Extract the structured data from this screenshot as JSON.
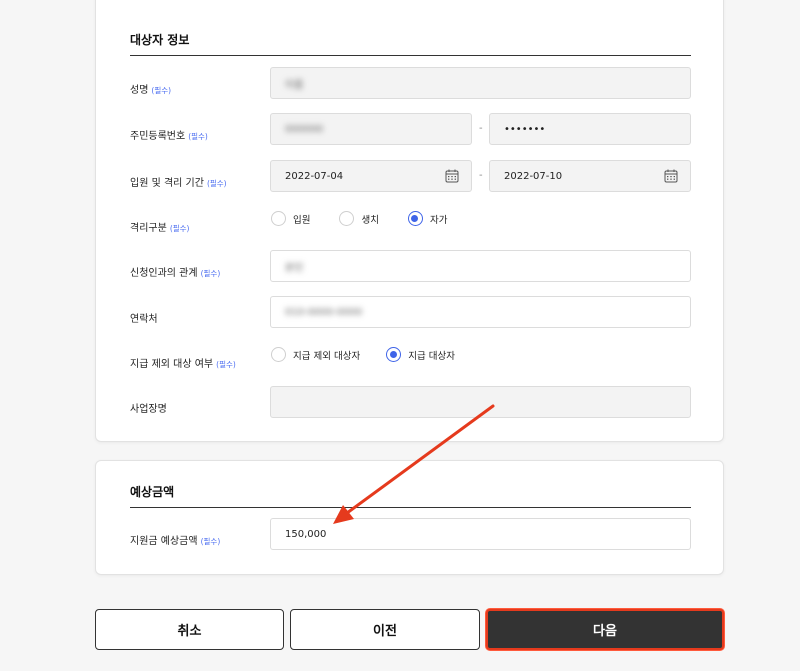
{
  "section1": {
    "title": "대상자 정보",
    "required_tag": "(필수)",
    "name": {
      "label": "성명",
      "value": "이름"
    },
    "rrn": {
      "label": "주민등록번호",
      "front_value": "000000",
      "separator": "-",
      "back_value": "•••••••"
    },
    "period": {
      "label": "입원 및 격리 기간",
      "start_date": "2022-07-04",
      "separator": "-",
      "end_date": "2022-07-10"
    },
    "quarantine_type": {
      "label": "격리구분",
      "options": [
        "입원",
        "생치",
        "자가"
      ],
      "selected": "자가"
    },
    "relation": {
      "label": "신청인과의 관계",
      "value": "본인"
    },
    "contact": {
      "label": "연락처",
      "value": "010-0000-0000"
    },
    "exclusion": {
      "label": "지급 제외 대상 여부",
      "options": [
        "지급 제외 대상자",
        "지급 대상자"
      ],
      "selected": "지급 대상자"
    },
    "workplace": {
      "label": "사업장명",
      "value": ""
    }
  },
  "section2": {
    "title": "예상금액",
    "amount": {
      "label": "지원금 예상금액",
      "value": "150,000"
    }
  },
  "buttons": {
    "cancel": "취소",
    "prev": "이전",
    "next": "다음"
  },
  "colors": {
    "accent": "#3f64e8",
    "primary_button": "#333333",
    "highlight": "#e53a1d"
  }
}
